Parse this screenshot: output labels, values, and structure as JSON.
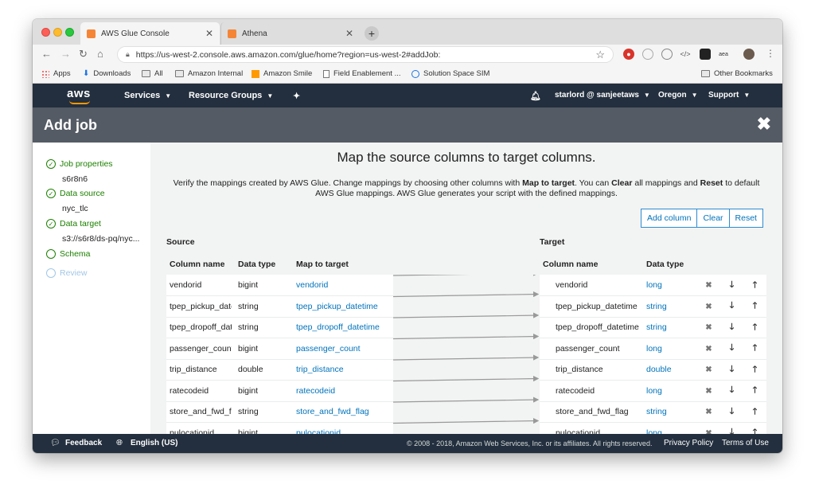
{
  "browser": {
    "tabs": [
      {
        "title": "AWS Glue Console",
        "active": true
      },
      {
        "title": "Athena",
        "active": false
      }
    ],
    "url": "https://us-west-2.console.aws.amazon.com/glue/home?region=us-west-2#addJob:",
    "bookmarks": [
      "Apps",
      "Downloads",
      "All",
      "Amazon Internal",
      "Amazon Smile",
      "Field Enablement ...",
      "Solution Space SIM",
      "Other Bookmarks"
    ]
  },
  "aws_nav": {
    "logo": "aws",
    "services": "Services",
    "resource_groups": "Resource Groups",
    "user": "starlord @ sanjeetaws",
    "region": "Oregon",
    "support": "Support"
  },
  "header": {
    "title": "Add job",
    "close": "✖"
  },
  "sidebar": {
    "steps": [
      {
        "label": "Job properties",
        "value": "s6r8n6",
        "state": "done"
      },
      {
        "label": "Data source",
        "value": "nyc_tlc",
        "state": "done"
      },
      {
        "label": "Data target",
        "value": "s3://s6r8/ds-pq/nyc...",
        "state": "done"
      },
      {
        "label": "Schema",
        "value": "",
        "state": "current"
      },
      {
        "label": "Review",
        "value": "",
        "state": "disabled"
      }
    ]
  },
  "main": {
    "heading": "Map the source columns to target columns.",
    "description_parts": [
      "Verify the mappings created by AWS Glue. Change mappings by choosing other columns with ",
      "Map to target",
      ". You can ",
      "Clear",
      " all mappings and ",
      "Reset",
      " to default AWS Glue mappings. AWS Glue generates your script with the defined mappings."
    ],
    "source_label": "Source",
    "target_label": "Target",
    "buttons": {
      "add_column": "Add column",
      "clear": "Clear",
      "reset": "Reset"
    },
    "source_headers": [
      "Column name",
      "Data type",
      "Map to target"
    ],
    "target_headers": [
      "Column name",
      "Data type"
    ],
    "source_rows": [
      {
        "name": "vendorid",
        "type": "bigint",
        "map": "vendorid"
      },
      {
        "name": "tpep_pickup_datetime",
        "type": "string",
        "map": "tpep_pickup_datetime"
      },
      {
        "name": "tpep_dropoff_datetime",
        "type": "string",
        "map": "tpep_dropoff_datetime"
      },
      {
        "name": "passenger_count",
        "type": "bigint",
        "map": "passenger_count"
      },
      {
        "name": "trip_distance",
        "type": "double",
        "map": "trip_distance"
      },
      {
        "name": "ratecodeid",
        "type": "bigint",
        "map": "ratecodeid"
      },
      {
        "name": "store_and_fwd_flag",
        "type": "string",
        "map": "store_and_fwd_flag"
      },
      {
        "name": "pulocationid",
        "type": "bigint",
        "map": "pulocationid"
      }
    ],
    "target_rows": [
      {
        "name": "vendorid",
        "type": "long"
      },
      {
        "name": "tpep_pickup_datetime",
        "type": "string"
      },
      {
        "name": "tpep_dropoff_datetime",
        "type": "string"
      },
      {
        "name": "passenger_count",
        "type": "long"
      },
      {
        "name": "trip_distance",
        "type": "double"
      },
      {
        "name": "ratecodeid",
        "type": "long"
      },
      {
        "name": "store_and_fwd_flag",
        "type": "string"
      },
      {
        "name": "pulocationid",
        "type": "long"
      }
    ]
  },
  "footer": {
    "feedback": "Feedback",
    "language": "English (US)",
    "copyright": "© 2008 - 2018, Amazon Web Services, Inc. or its affiliates. All rights reserved.",
    "privacy": "Privacy Policy",
    "terms": "Terms of Use"
  }
}
